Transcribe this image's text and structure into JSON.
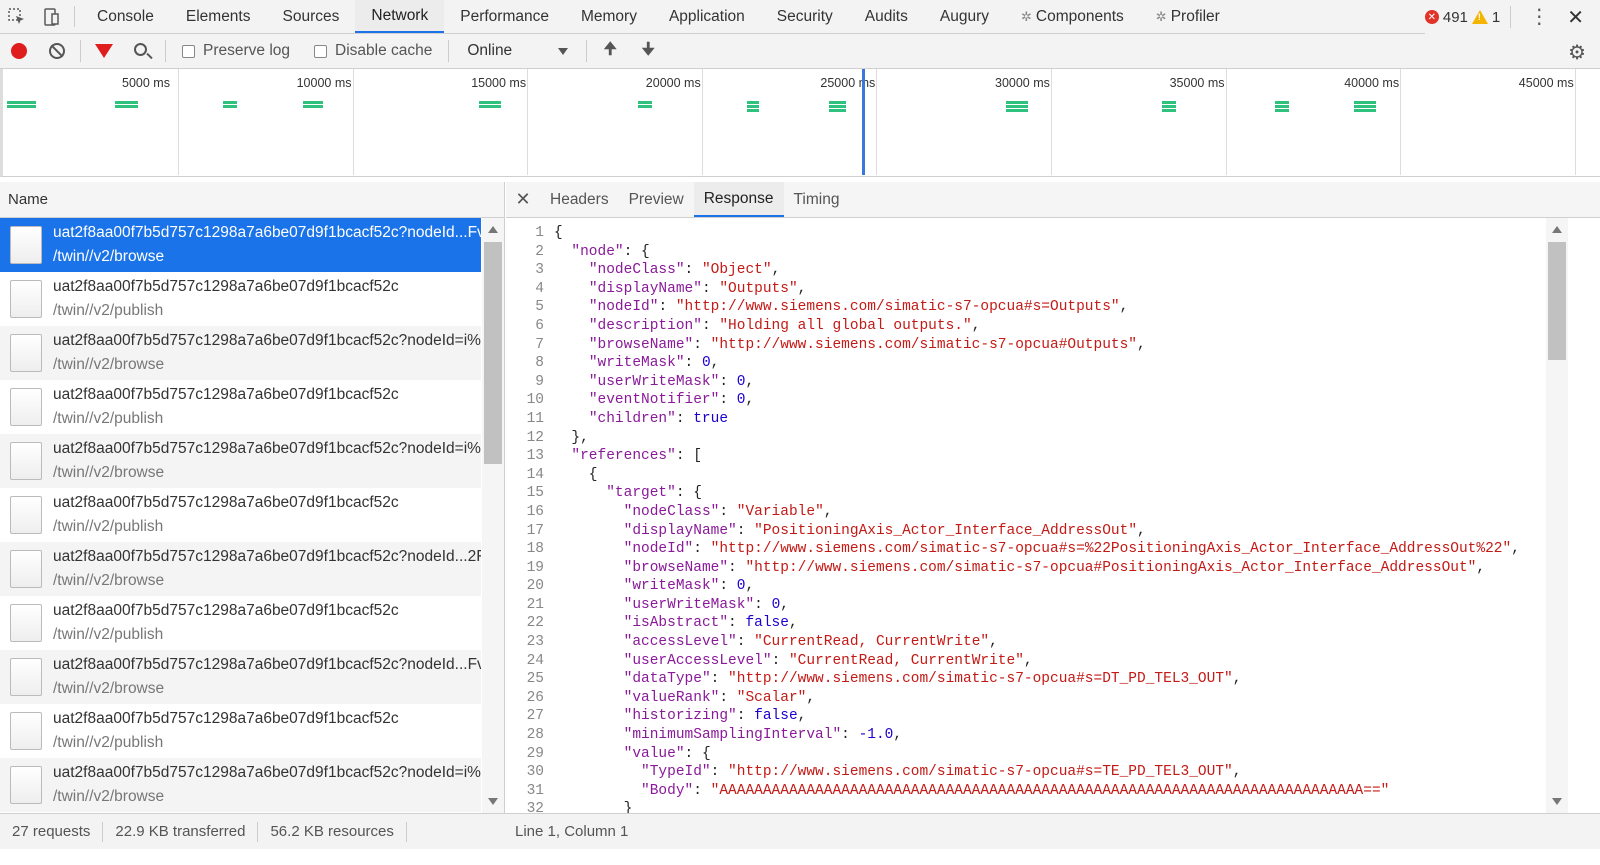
{
  "top_tabs": [
    {
      "label": "Console"
    },
    {
      "label": "Elements"
    },
    {
      "label": "Sources"
    },
    {
      "label": "Network"
    },
    {
      "label": "Performance"
    },
    {
      "label": "Memory"
    },
    {
      "label": "Application"
    },
    {
      "label": "Security"
    },
    {
      "label": "Audits"
    },
    {
      "label": "Augury"
    },
    {
      "label": "Components"
    },
    {
      "label": "Profiler"
    }
  ],
  "errors_count": "491",
  "warnings_count": "1",
  "toolbar": {
    "preserve_log": "Preserve log",
    "disable_cache": "Disable cache",
    "throttle": "Online"
  },
  "overview": {
    "labels": [
      "5000 ms",
      "10000 ms",
      "15000 ms",
      "20000 ms",
      "25000 ms",
      "30000 ms",
      "35000 ms",
      "40000 ms",
      "45000 ms"
    ]
  },
  "requests": {
    "header": "Name",
    "rows": [
      {
        "name": "uat2f8aa00f7b5d757c1298a7a6be07d9f1bcacf52c?nodeId...Fv",
        "path": "/twin//v2/browse"
      },
      {
        "name": "uat2f8aa00f7b5d757c1298a7a6be07d9f1bcacf52c",
        "path": "/twin//v2/publish"
      },
      {
        "name": "uat2f8aa00f7b5d757c1298a7a6be07d9f1bcacf52c?nodeId=i%",
        "path": "/twin//v2/browse"
      },
      {
        "name": "uat2f8aa00f7b5d757c1298a7a6be07d9f1bcacf52c",
        "path": "/twin//v2/publish"
      },
      {
        "name": "uat2f8aa00f7b5d757c1298a7a6be07d9f1bcacf52c?nodeId=i%",
        "path": "/twin//v2/browse"
      },
      {
        "name": "uat2f8aa00f7b5d757c1298a7a6be07d9f1bcacf52c",
        "path": "/twin//v2/publish"
      },
      {
        "name": "uat2f8aa00f7b5d757c1298a7a6be07d9f1bcacf52c?nodeId...2F",
        "path": "/twin//v2/browse"
      },
      {
        "name": "uat2f8aa00f7b5d757c1298a7a6be07d9f1bcacf52c",
        "path": "/twin//v2/publish"
      },
      {
        "name": "uat2f8aa00f7b5d757c1298a7a6be07d9f1bcacf52c?nodeId...Fv",
        "path": "/twin//v2/browse"
      },
      {
        "name": "uat2f8aa00f7b5d757c1298a7a6be07d9f1bcacf52c",
        "path": "/twin//v2/publish"
      },
      {
        "name": "uat2f8aa00f7b5d757c1298a7a6be07d9f1bcacf52c?nodeId=i%",
        "path": "/twin//v2/browse"
      }
    ]
  },
  "detail_tabs": [
    {
      "label": "Headers"
    },
    {
      "label": "Preview"
    },
    {
      "label": "Response"
    },
    {
      "label": "Timing"
    }
  ],
  "response_lines": [
    "{",
    "  \"node\": {",
    "    \"nodeClass\": \"Object\",",
    "    \"displayName\": \"Outputs\",",
    "    \"nodeId\": \"http://www.siemens.com/simatic-s7-opcua#s=Outputs\",",
    "    \"description\": \"Holding all global outputs.\",",
    "    \"browseName\": \"http://www.siemens.com/simatic-s7-opcua#Outputs\",",
    "    \"writeMask\": 0,",
    "    \"userWriteMask\": 0,",
    "    \"eventNotifier\": 0,",
    "    \"children\": true",
    "  },",
    "  \"references\": [",
    "    {",
    "      \"target\": {",
    "        \"nodeClass\": \"Variable\",",
    "        \"displayName\": \"PositioningAxis_Actor_Interface_AddressOut\",",
    "        \"nodeId\": \"http://www.siemens.com/simatic-s7-opcua#s=%22PositioningAxis_Actor_Interface_AddressOut%22\",",
    "        \"browseName\": \"http://www.siemens.com/simatic-s7-opcua#PositioningAxis_Actor_Interface_AddressOut\",",
    "        \"writeMask\": 0,",
    "        \"userWriteMask\": 0,",
    "        \"isAbstract\": false,",
    "        \"accessLevel\": \"CurrentRead, CurrentWrite\",",
    "        \"userAccessLevel\": \"CurrentRead, CurrentWrite\",",
    "        \"dataType\": \"http://www.siemens.com/simatic-s7-opcua#s=DT_PD_TEL3_OUT\",",
    "        \"valueRank\": \"Scalar\",",
    "        \"historizing\": false,",
    "        \"minimumSamplingInterval\": -1.0,",
    "        \"value\": {",
    "          \"TypeId\": \"http://www.siemens.com/simatic-s7-opcua#s=TE_PD_TEL3_OUT\",",
    "          \"Body\": \"AAAAAAAAAAAAAAAAAAAAAAAAAAAAAAAAAAAAAAAAAAAAAAAAAAAAAAAAAAAAAAAAAAAAAAAAAA==\"",
    "        }"
  ],
  "status": {
    "requests": "27 requests",
    "transferred": "22.9 KB transferred",
    "resources": "56.2 KB resources",
    "cursor": "Line 1, Column 1"
  }
}
